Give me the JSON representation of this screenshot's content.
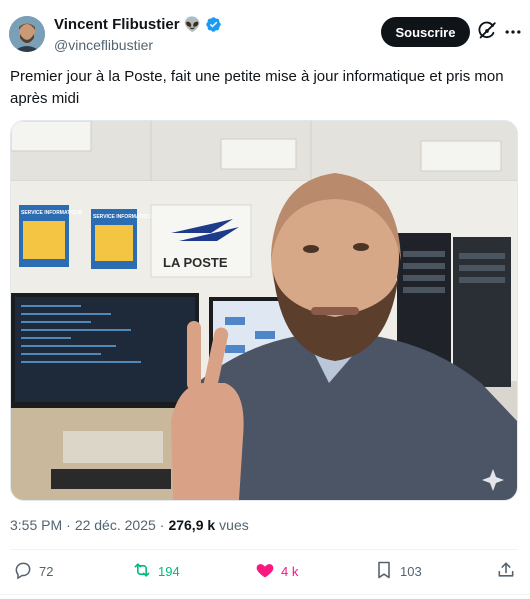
{
  "author": {
    "name": "Vincent Flibustier",
    "emoji": "👽",
    "handle": "@vinceflibustier",
    "verified": true
  },
  "follow_button": {
    "label": "Souscrire"
  },
  "icons": {
    "grok": "grok-icon",
    "more": "more-icon",
    "verified": "verified-badge-icon",
    "reply": "reply-icon",
    "repost": "repost-icon",
    "like": "like-icon",
    "bookmark": "bookmark-icon",
    "share": "share-icon"
  },
  "tweet": {
    "text": "Premier jour à la Poste, fait une petite mise à jour informatique et pris mon après midi"
  },
  "photo": {
    "wall_sign": "LA POSTE",
    "poster_1": "SERVICE INFORMATIQUE",
    "poster_2": "SERVICE INFORMATIQUE"
  },
  "meta": {
    "time": "3:55 PM",
    "separator": "·",
    "date": "22 déc. 2025",
    "views": "276,9 k",
    "views_label": "vues"
  },
  "actions": {
    "replies": "72",
    "reposts": "194",
    "likes": "4 k",
    "bookmarks": "103"
  },
  "colors": {
    "text": "#0f1419",
    "muted": "#536471",
    "repost_active": "#00ba7c",
    "like_active": "#f91880",
    "verified_blue": "#1d9bf0"
  }
}
